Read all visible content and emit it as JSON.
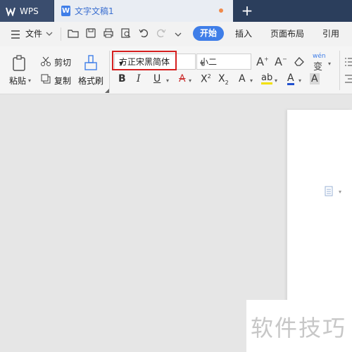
{
  "tabs": {
    "app_label": "WPS",
    "doc_label": "文字文稿1",
    "new_tab_symbol": "+"
  },
  "menu": {
    "file_label": "文件",
    "start_label": "开始",
    "insert_label": "插入",
    "layout_label": "页面布局",
    "reference_label": "引用"
  },
  "ribbon": {
    "paste_label": "粘贴",
    "cut_label": "剪切",
    "copy_label": "复制",
    "format_painter_label": "格式刷",
    "font_name": "方正宋黑简体",
    "font_size": "小二",
    "pinyin_label": "wén"
  },
  "watermark_text": "软件技巧",
  "colors": {
    "accent": "#3f7ee8",
    "highlight_box": "#d62020",
    "font_color_bar": "#2050d0"
  }
}
